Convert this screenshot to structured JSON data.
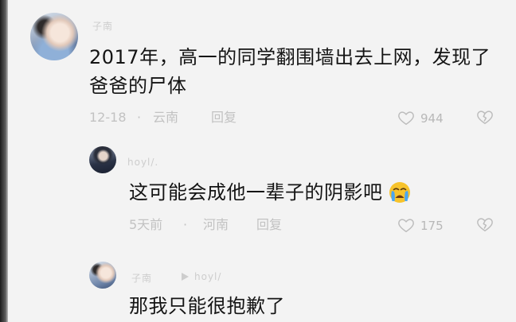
{
  "top_comment": {
    "username": "子南",
    "avatar_icon": "user-avatar",
    "text_lines": [
      "2017年，高一的同学翻围墙出去上网，发现了",
      "爸爸的尸体"
    ],
    "date": "12-18",
    "separator": "·",
    "location": "云南",
    "reply_label": "回复",
    "like_icon": "heart-outline-icon",
    "like_count": "944",
    "dislike_icon": "broken-heart-icon"
  },
  "replies": [
    {
      "username": "hoyl/.",
      "avatar_icon": "user-avatar",
      "text": "这可能会成他一辈子的阴影吧",
      "emoji_icon": "loudly-crying-face",
      "date": "5天前",
      "separator": "·",
      "location": "河南",
      "reply_label": "回复",
      "like_icon": "heart-outline-icon",
      "like_count": "175",
      "dislike_icon": "broken-heart-icon"
    },
    {
      "username": "子南",
      "avatar_icon": "user-avatar",
      "reply_arrow_icon": "play-arrow-icon",
      "reply_to": "hoyl/",
      "text": "那我只能很抱歉了"
    }
  ],
  "colors": {
    "background": "#f3f3f3",
    "text": "#141414",
    "meta": "#c2c2c2",
    "icon": "#bcbcbc",
    "emoji": "#f7c32b"
  }
}
